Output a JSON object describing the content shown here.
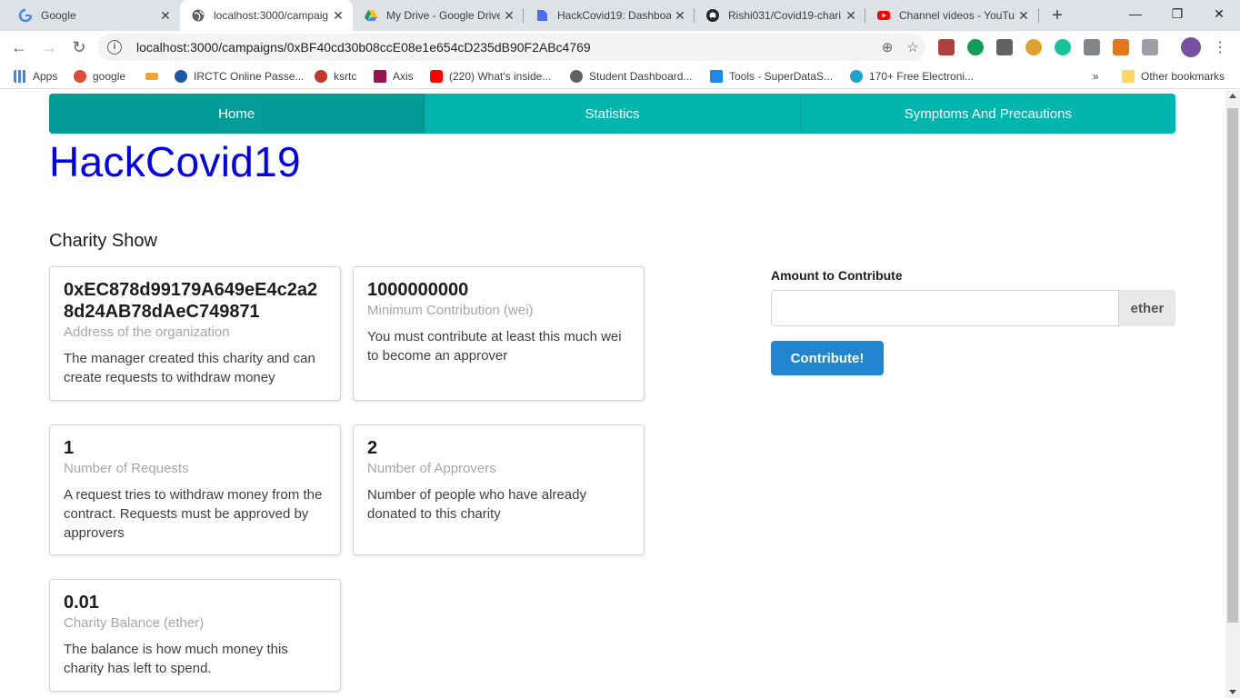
{
  "browser": {
    "tabs": [
      {
        "title": "Google",
        "icon": "google-icon",
        "active": false
      },
      {
        "title": "localhost:3000/campaig",
        "icon": "globe-icon",
        "active": true
      },
      {
        "title": "My Drive - Google Drive",
        "icon": "drive-icon",
        "active": false
      },
      {
        "title": "HackCovid19: Dashboar",
        "icon": "doc-icon",
        "active": false
      },
      {
        "title": "Rishi031/Covid19-chari",
        "icon": "github-icon",
        "active": false
      },
      {
        "title": "Channel videos - YouTu",
        "icon": "youtube-icon",
        "active": false
      }
    ],
    "url": "localhost:3000/campaigns/0xBF40cd30b08ccE08e1e654cD235dB90F2ABc4769",
    "bookmarks": [
      {
        "label": "Apps",
        "icon": "apps-grid-icon"
      },
      {
        "label": "google",
        "icon": "google-plus-icon"
      },
      {
        "label": "",
        "icon": "irctc-icon"
      },
      {
        "label": "IRCTC Online Passe...",
        "icon": "irctc-logo-icon"
      },
      {
        "label": "ksrtc",
        "icon": "ksrtc-icon"
      },
      {
        "label": "Axis",
        "icon": "axis-icon"
      },
      {
        "label": "(220) What's inside...",
        "icon": "youtube-icon"
      },
      {
        "label": "Student Dashboard...",
        "icon": "globe-icon"
      },
      {
        "label": "Tools - SuperDataS...",
        "icon": "s-icon"
      },
      {
        "label": "170+ Free Electroni...",
        "icon": "e-icon"
      }
    ],
    "other_bookmarks": "Other bookmarks",
    "colors": {
      "tabstrip": "#dee1e6",
      "omnibox": "#f1f3f4"
    }
  },
  "nav": {
    "items": [
      {
        "label": "Home",
        "active": true
      },
      {
        "label": "Statistics",
        "active": false
      },
      {
        "label": "Symptoms And Precautions",
        "active": false
      }
    ],
    "color": "#00b5ad"
  },
  "brand": "HackCovid19",
  "page_title": "Charity Show",
  "cards": [
    {
      "header": "0xEC878d99179A649eE4c2a28d24AB78dAeC749871",
      "meta": "Address of the organization",
      "description": "The manager created this charity and can create requests to withdraw money"
    },
    {
      "header": "1000000000",
      "meta": "Minimum Contribution (wei)",
      "description": "You must contribute at least this much wei to become an approver"
    },
    {
      "header": "1",
      "meta": "Number of Requests",
      "description": "A request tries to withdraw money from the contract. Requests must be approved by approvers"
    },
    {
      "header": "2",
      "meta": "Number of Approvers",
      "description": "Number of people who have already donated to this charity"
    },
    {
      "header": "0.01",
      "meta": "Charity Balance (ether)",
      "description": "The balance is how much money this charity has left to spend."
    }
  ],
  "contribute": {
    "label": "Amount to Contribute",
    "value": "",
    "unit": "ether",
    "button": "Contribute!",
    "button_color": "#2185d0"
  }
}
